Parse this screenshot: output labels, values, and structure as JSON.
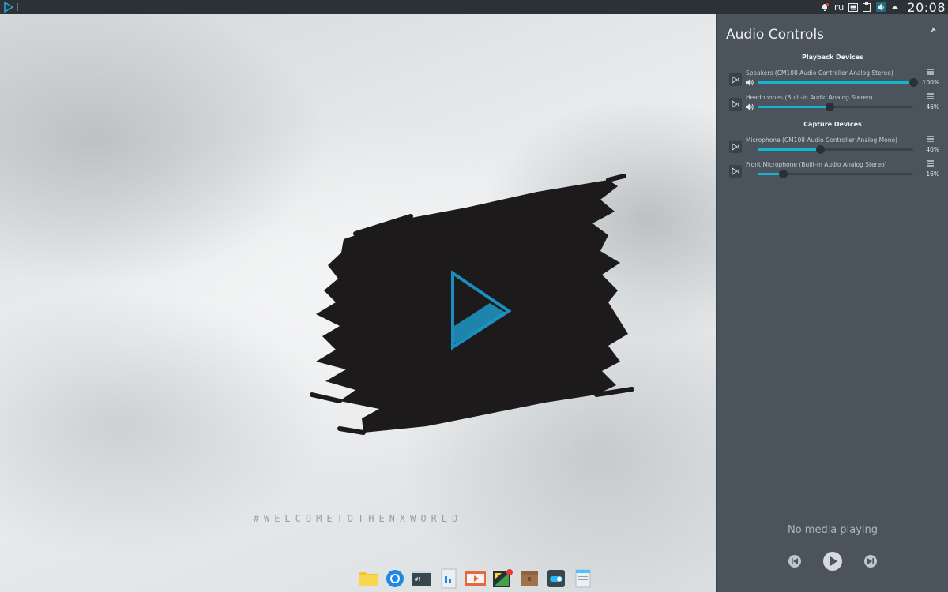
{
  "topbar": {
    "logo_icon": "nx-logo-icon",
    "tray": {
      "notifications_icon": "bell-muted-icon",
      "language": "ru",
      "keyboard_icon": "keyboard-icon",
      "clipboard_icon": "clipboard-icon",
      "volume_icon": "speaker-icon",
      "expand_icon": "caret-up-icon"
    },
    "clock": "20:08"
  },
  "desktop": {
    "tagline": "#WELCOMETOTHENXWORLD",
    "dock_items": [
      {
        "name": "file-manager",
        "icon": "folder-icon"
      },
      {
        "name": "web-browser",
        "icon": "browser-icon"
      },
      {
        "name": "terminal",
        "icon": "terminal-icon"
      },
      {
        "name": "text-editor",
        "icon": "document-icon"
      },
      {
        "name": "media-player",
        "icon": "media-player-icon"
      },
      {
        "name": "software-center",
        "icon": "store-icon"
      },
      {
        "name": "archive-manager",
        "icon": "archive-icon"
      },
      {
        "name": "settings",
        "icon": "toggle-settings-icon"
      },
      {
        "name": "notes",
        "icon": "notes-icon"
      }
    ]
  },
  "panel": {
    "title": "Audio Controls",
    "playback_title": "Playback Devices",
    "capture_title": "Capture Devices",
    "playback": [
      {
        "name": "Speakers (CM108 Audio Controller Analog Stereo)",
        "percent": "100%",
        "level": 1.0
      },
      {
        "name": "Headphones (Built-in Audio Analog Stereo)",
        "percent": "46%",
        "level": 0.46
      }
    ],
    "capture": [
      {
        "name": "Microphone (CM108 Audio Controller Analog Mono)",
        "percent": "40%",
        "level": 0.4
      },
      {
        "name": "Front Microphone (Built-in Audio Analog Stereo)",
        "percent": "16%",
        "level": 0.16
      }
    ],
    "media_status": "No media playing",
    "accent_color": "#15b5d2"
  }
}
